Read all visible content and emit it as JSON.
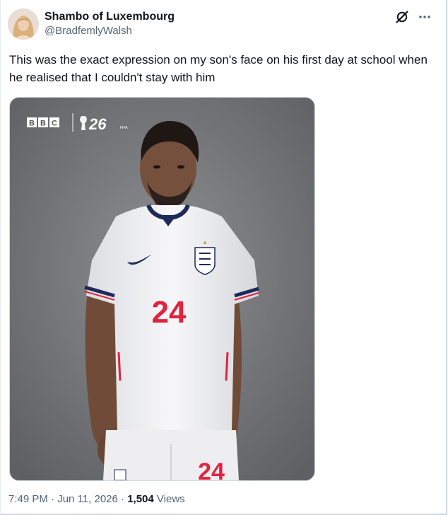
{
  "author": {
    "display_name": "Shambo of Luxembourg",
    "handle": "@BradfemlyWalsh"
  },
  "icons": {
    "grok": "grok-icon",
    "more": "more-icon"
  },
  "tweet": {
    "text": "This was the exact expression on my son's face on his first day at school when he realised that I couldn't stay with him"
  },
  "media": {
    "bbc_letters": [
      "B",
      "B",
      "C"
    ],
    "event_logo_text": "26",
    "fifa_text": "FIFA",
    "shirt_number": "24",
    "shorts_number": "24"
  },
  "meta": {
    "time": "7:49 PM",
    "sep1": "·",
    "date": "Jun 11, 2026",
    "sep2": "·",
    "views_count": "1,504",
    "views_label": "Views"
  },
  "colors": {
    "text": "#0f1419",
    "muted": "#536471",
    "shirt_red": "#e0233f",
    "shirt_navy": "#1d2a5a"
  }
}
